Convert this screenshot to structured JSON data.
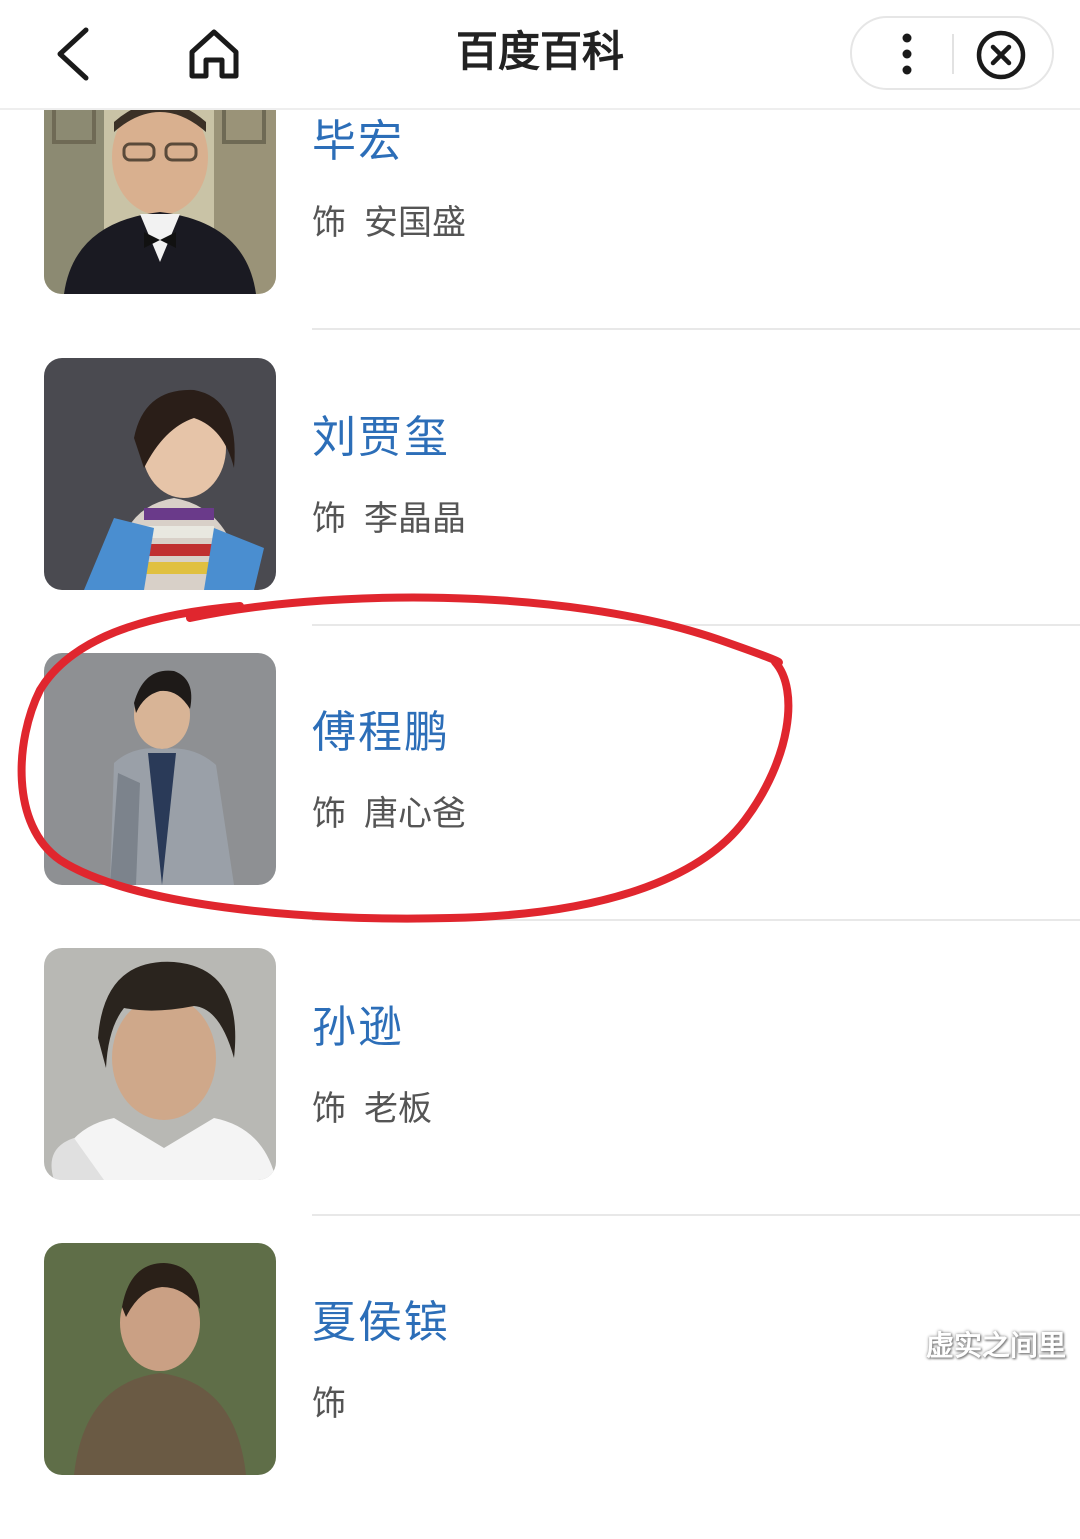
{
  "header": {
    "title": "百度百科"
  },
  "cast": [
    {
      "name": "毕宏",
      "role_prefix": "饰",
      "role": "安国盛"
    },
    {
      "name": "刘贾玺",
      "role_prefix": "饰",
      "role": "李晶晶"
    },
    {
      "name": "傅程鹏",
      "role_prefix": "饰",
      "role": "唐心爸"
    },
    {
      "name": "孙逊",
      "role_prefix": "饰",
      "role": "老板"
    },
    {
      "name": "夏侯镔",
      "role_prefix": "饰",
      "role": ""
    }
  ],
  "watermark": "虚实之间里",
  "colors": {
    "name_link": "#2c6eb8",
    "highlight_ring": "#e0262e",
    "text_secondary": "#555555"
  },
  "icons": [
    "back-arrow-icon",
    "home-icon",
    "more-dots-icon",
    "close-circle-icon"
  ]
}
